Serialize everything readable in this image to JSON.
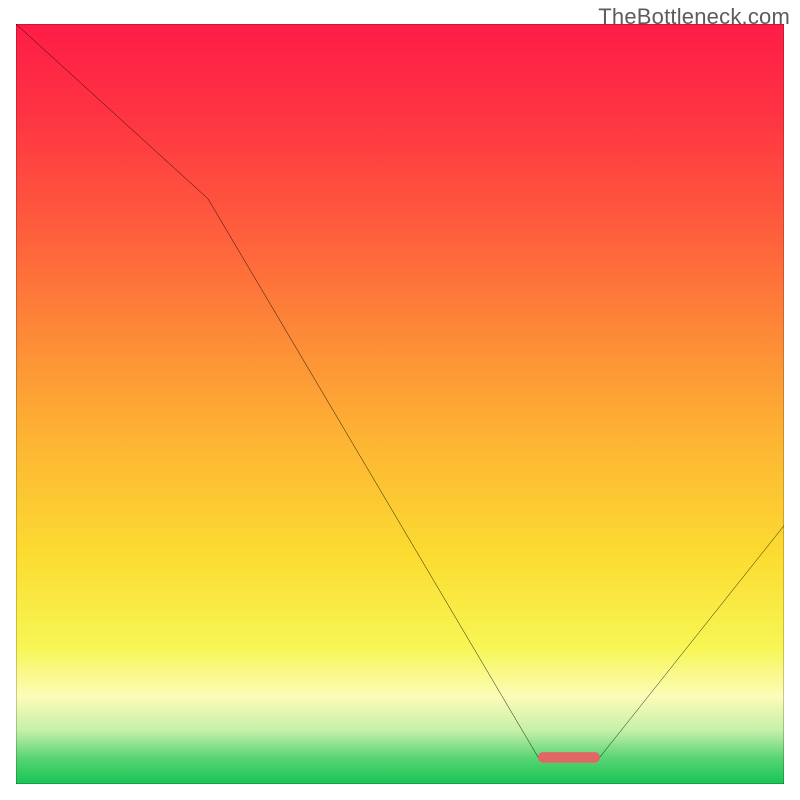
{
  "watermark": "TheBottleneck.com",
  "chart_data": {
    "type": "line",
    "title": "",
    "xlabel": "",
    "ylabel": "",
    "xlim": [
      0,
      100
    ],
    "ylim": [
      0,
      100
    ],
    "grid": false,
    "series": [
      {
        "name": "curve",
        "x": [
          0,
          25,
          68,
          76,
          100
        ],
        "values": [
          100,
          77,
          3.5,
          3.5,
          34
        ]
      }
    ],
    "highlight_segment": {
      "x0": 68,
      "x1": 76,
      "y": 3.5
    },
    "background_gradient_stops": [
      {
        "pos": 0.0,
        "color": "#fe1c46"
      },
      {
        "pos": 0.12,
        "color": "#fe3442"
      },
      {
        "pos": 0.26,
        "color": "#fe5a3d"
      },
      {
        "pos": 0.4,
        "color": "#fd8738"
      },
      {
        "pos": 0.55,
        "color": "#fdb533"
      },
      {
        "pos": 0.7,
        "color": "#fcdc31"
      },
      {
        "pos": 0.82,
        "color": "#f7f654"
      },
      {
        "pos": 0.885,
        "color": "#fcfcb9"
      },
      {
        "pos": 0.93,
        "color": "#c5f0a8"
      },
      {
        "pos": 0.965,
        "color": "#5ad574"
      },
      {
        "pos": 1.0,
        "color": "#17c455"
      }
    ],
    "marker_color": "#e16767",
    "line_color": "#000000",
    "frame_color": "#000000"
  }
}
